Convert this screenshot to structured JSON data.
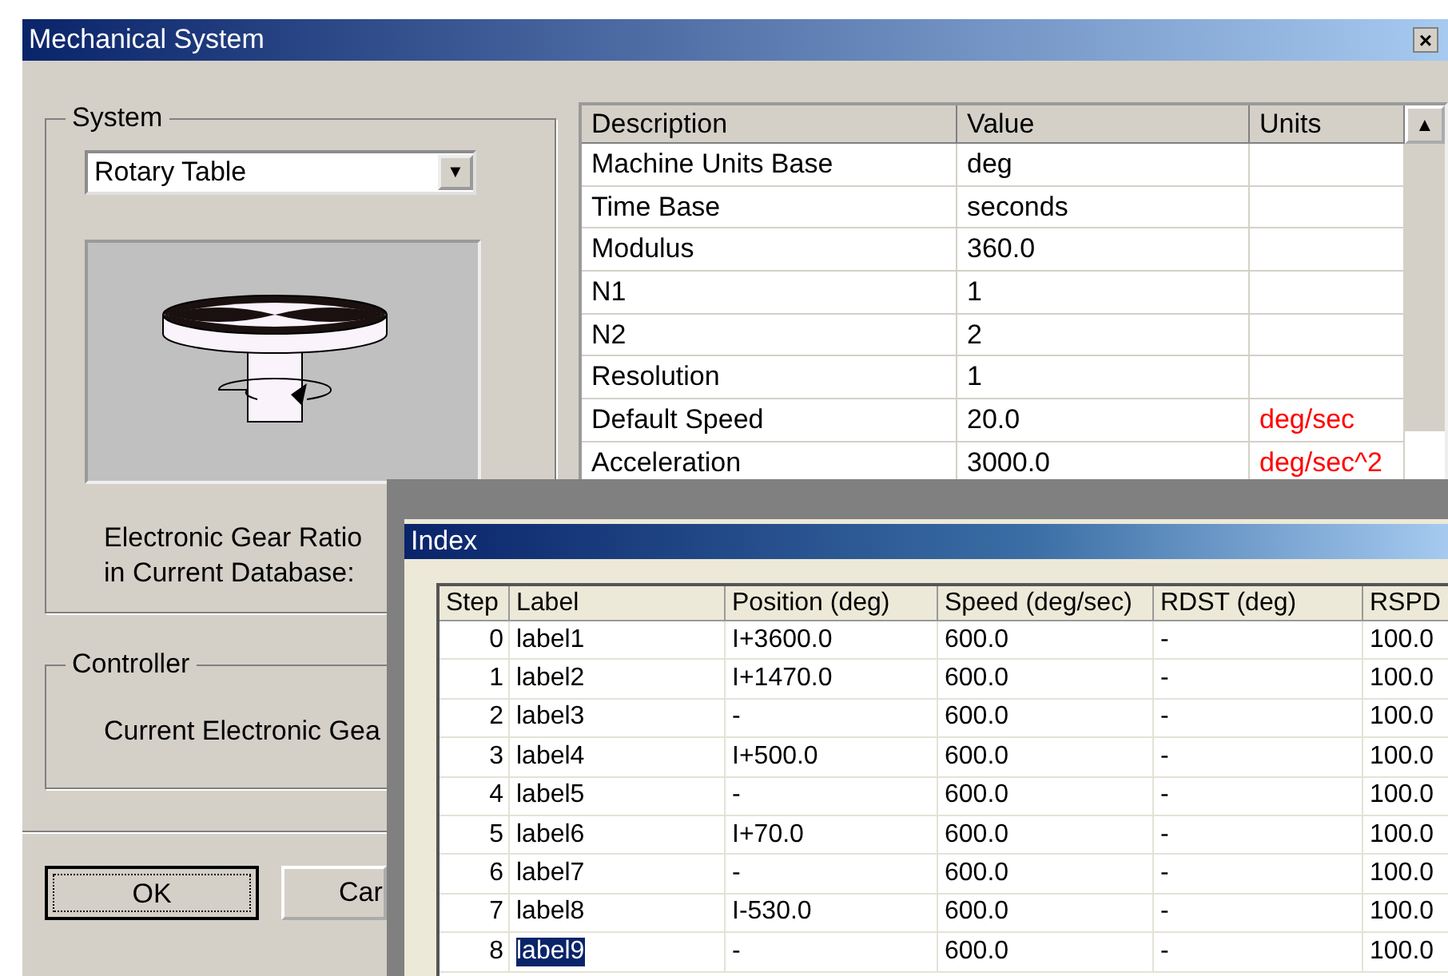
{
  "window": {
    "title": "Mechanical System",
    "close": "×"
  },
  "system": {
    "legend": "System",
    "dropdown": {
      "value": "Rotary Table",
      "arrow": "▼"
    },
    "picture": {
      "kind": "rotary-table"
    },
    "ratio_label": "Electronic Gear Ratio\nin Current Database:"
  },
  "controller": {
    "legend": "Controller",
    "text": "Current Electronic Gea"
  },
  "buttons": [
    {
      "label": "OK",
      "focused": true
    },
    {
      "label": "Car",
      "focused": false
    }
  ],
  "parameters": {
    "columns": [
      "Description",
      "Value",
      "Units"
    ],
    "scroll_up": "▲",
    "rows": [
      {
        "description": "Machine Units Base",
        "value": "deg"
      },
      {
        "description": "Time Base",
        "value": "seconds"
      },
      {
        "description": "Modulus",
        "value": "360.0"
      },
      {
        "description": "N1",
        "value": "1"
      },
      {
        "description": "N2",
        "value": "2"
      },
      {
        "description": "Resolution",
        "value": "1"
      },
      {
        "description": "Default Speed",
        "value": "20.0",
        "units": "deg/sec",
        "color": "#ff0000"
      },
      {
        "description": "Acceleration",
        "value": "3000.0",
        "units": "deg/sec^2",
        "color": "#ff0000"
      }
    ]
  },
  "index_window": {
    "title": "Index",
    "columns": [
      "Step",
      "Label",
      "Position (deg)",
      "Speed (deg/sec)",
      "RDST (deg)",
      "RSPD"
    ],
    "rows": [
      {
        "cells": [
          "0",
          "label1",
          "I+3600.0",
          "600.0",
          "-",
          "100.0"
        ],
        "selected": false
      },
      {
        "cells": [
          "1",
          "label2",
          "I+1470.0",
          "600.0",
          "-",
          "100.0"
        ],
        "selected": false
      },
      {
        "cells": [
          "2",
          "label3",
          "-",
          "600.0",
          "-",
          "100.0"
        ],
        "selected": false
      },
      {
        "cells": [
          "3",
          "label4",
          "I+500.0",
          "600.0",
          "-",
          "100.0"
        ],
        "selected": false
      },
      {
        "cells": [
          "4",
          "label5",
          "-",
          "600.0",
          "-",
          "100.0"
        ],
        "selected": false
      },
      {
        "cells": [
          "5",
          "label6",
          "I+70.0",
          "600.0",
          "-",
          "100.0"
        ],
        "selected": false
      },
      {
        "cells": [
          "6",
          "label7",
          "-",
          "600.0",
          "-",
          "100.0"
        ],
        "selected": false
      },
      {
        "cells": [
          "7",
          "label8",
          "I-530.0",
          "600.0",
          "-",
          "100.0"
        ],
        "selected": false
      },
      {
        "cells": [
          "8",
          "label9",
          "-",
          "600.0",
          "-",
          "100.0"
        ],
        "selected": true
      }
    ]
  }
}
